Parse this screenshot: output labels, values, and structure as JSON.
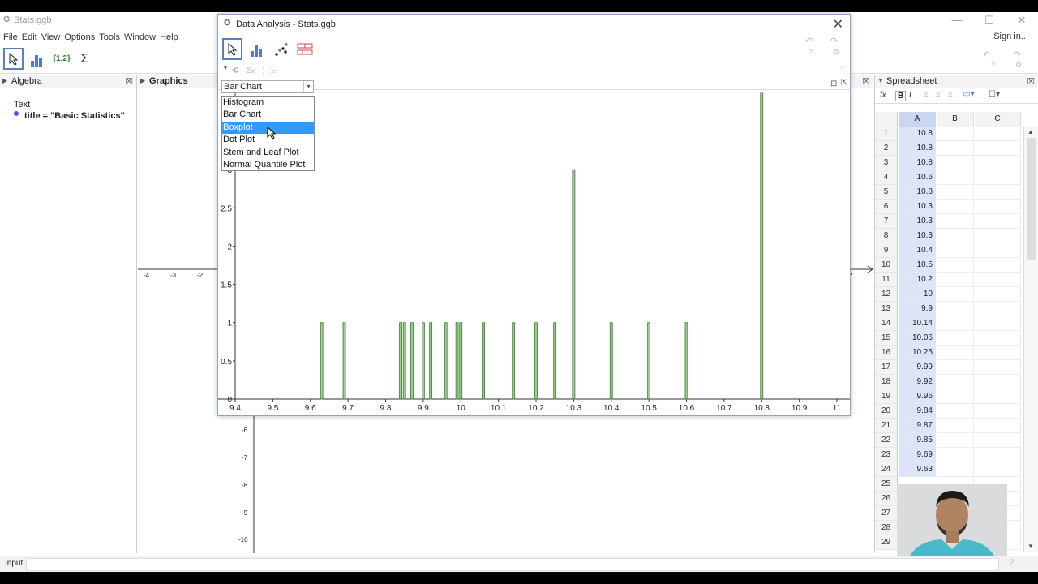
{
  "app": {
    "title": "Stats.ggb",
    "sign_in": "Sign in...",
    "menu": [
      "File",
      "Edit",
      "View",
      "Options",
      "Tools",
      "Window",
      "Help"
    ],
    "toolbar_icons": [
      "move-tool-icon",
      "bar-chart-tool-icon",
      "list-tool-icon",
      "sum-tool-icon"
    ],
    "toolbar_list_label": "{1,2}",
    "toolbar_sum_label": "Σ"
  },
  "algebra": {
    "header": "Algebra",
    "category": "Text",
    "item": "title = \"Basic Statistics\""
  },
  "graphics": {
    "header": "Graphics",
    "x_ticks": [
      "-4",
      "-3",
      "-2"
    ],
    "right_tick": "2",
    "y_ticks": [
      "-6",
      "-7",
      "-8",
      "-9",
      "-10"
    ]
  },
  "spreadsheet": {
    "header": "Spreadsheet",
    "fx": "fx",
    "bold": "B",
    "italic": "I",
    "columns": [
      "A",
      "B",
      "C"
    ],
    "rows": [
      {
        "n": "1",
        "a": "10.8"
      },
      {
        "n": "2",
        "a": "10.8"
      },
      {
        "n": "3",
        "a": "10.8"
      },
      {
        "n": "4",
        "a": "10.6"
      },
      {
        "n": "5",
        "a": "10.8"
      },
      {
        "n": "6",
        "a": "10.3"
      },
      {
        "n": "7",
        "a": "10.3"
      },
      {
        "n": "8",
        "a": "10.3"
      },
      {
        "n": "9",
        "a": "10.4"
      },
      {
        "n": "10",
        "a": "10.5"
      },
      {
        "n": "11",
        "a": "10.2"
      },
      {
        "n": "12",
        "a": "10"
      },
      {
        "n": "13",
        "a": "9.9"
      },
      {
        "n": "14",
        "a": "10.14"
      },
      {
        "n": "15",
        "a": "10.06"
      },
      {
        "n": "16",
        "a": "10.25"
      },
      {
        "n": "17",
        "a": "9.99"
      },
      {
        "n": "18",
        "a": "9.92"
      },
      {
        "n": "19",
        "a": "9.96"
      },
      {
        "n": "20",
        "a": "9.84"
      },
      {
        "n": "21",
        "a": "9.87"
      },
      {
        "n": "22",
        "a": "9.85"
      },
      {
        "n": "23",
        "a": "9.69"
      },
      {
        "n": "24",
        "a": "9.63"
      },
      {
        "n": "25",
        "a": ""
      },
      {
        "n": "26",
        "a": ""
      },
      {
        "n": "27",
        "a": ""
      },
      {
        "n": "28",
        "a": ""
      },
      {
        "n": "29",
        "a": ""
      }
    ]
  },
  "input_bar": {
    "label": "Input:",
    "value": ""
  },
  "dialog": {
    "title": "Data Analysis - Stats.ggb",
    "chart_type": "Bar Chart",
    "options": [
      "Histogram",
      "Bar Chart",
      "Boxplot",
      "Dot Plot",
      "Stem and Leaf Plot",
      "Normal Quantile Plot"
    ],
    "selected_option": "Boxplot"
  },
  "colors": {
    "bar_fill": "#9ecb91",
    "bar_stroke": "#3d7a34",
    "selection": "#3399ff",
    "spreadsheet_fill": "#dbe5f7"
  },
  "chart_data": {
    "type": "bar",
    "title": "",
    "xlabel": "",
    "ylabel": "",
    "xlim": [
      9.4,
      11.0
    ],
    "ylim": [
      0,
      3.5
    ],
    "x_ticks": [
      "9.4",
      "9.5",
      "9.6",
      "9.7",
      "9.8",
      "9.9",
      "10",
      "10.1",
      "10.2",
      "10.3",
      "10.4",
      "10.5",
      "10.6",
      "10.7",
      "10.8",
      "10.9",
      "11"
    ],
    "y_ticks": [
      "0",
      "0.5",
      "1",
      "1.5",
      "2",
      "2.5",
      "3"
    ],
    "x": [
      9.63,
      9.69,
      9.84,
      9.85,
      9.87,
      9.9,
      9.92,
      9.96,
      9.99,
      10,
      10.06,
      10.14,
      10.2,
      10.25,
      10.3,
      10.4,
      10.5,
      10.6,
      10.8
    ],
    "values": [
      1,
      1,
      1,
      1,
      1,
      1,
      1,
      1,
      1,
      1,
      1,
      1,
      1,
      1,
      3,
      1,
      1,
      1,
      4
    ],
    "grid": false
  }
}
